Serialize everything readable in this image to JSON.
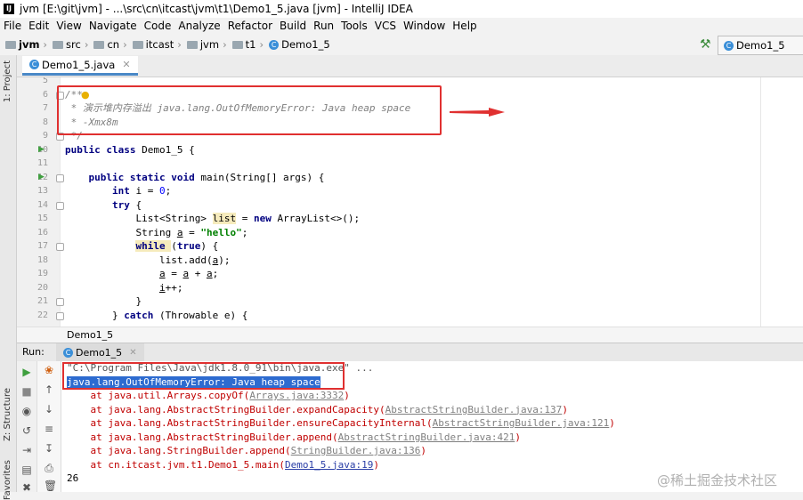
{
  "window": {
    "title": "jvm [E:\\git\\jvm] - ...\\src\\cn\\itcast\\jvm\\t1\\Demo1_5.java [jvm] - IntelliJ IDEA"
  },
  "menu": [
    "File",
    "Edit",
    "View",
    "Navigate",
    "Code",
    "Analyze",
    "Refactor",
    "Build",
    "Run",
    "Tools",
    "VCS",
    "Window",
    "Help"
  ],
  "breadcrumb": [
    "jvm",
    "src",
    "cn",
    "itcast",
    "jvm",
    "t1",
    "Demo1_5"
  ],
  "run_config": "Demo1_5",
  "left_strip": {
    "project": "1: Project",
    "structure": "Z: Structure",
    "favorites": "Favorites"
  },
  "editor_tab": "Demo1_5.java",
  "line_numbers": [
    "5",
    "6",
    "7",
    "8",
    "9",
    "10",
    "11",
    "12",
    "13",
    "14",
    "15",
    "16",
    "17",
    "18",
    "19",
    "20",
    "21",
    "22"
  ],
  "code": {
    "l6": "/**",
    "l7": " * 演示堆内存溢出 java.lang.OutOfMemoryError: Java heap space",
    "l8": " * -Xmx8m",
    "l9": " */",
    "l10a": "public class ",
    "l10b": "Demo1_5 {",
    "l12a": "public static void ",
    "l12b": "main(String[] args) {",
    "l13a": "int ",
    "l13b": "i = ",
    "l13c": "0",
    "l13d": ";",
    "l14a": "try ",
    "l14b": "{",
    "l15a": "List<String> ",
    "l15b": "list",
    "l15c": " = ",
    "l15d": "new ",
    "l15e": "ArrayList<>();",
    "l16a": "String ",
    "l16b": "a",
    "l16c": " = ",
    "l16d": "\"hello\"",
    "l16e": ";",
    "l17a": "while ",
    "l17b": "(",
    "l17c": "true",
    "l17d": ") {",
    "l18a": "list.add(",
    "l18b": "a",
    "l18c": ");",
    "l19a": "a",
    "l19b": " = ",
    "l19c": "a",
    "l19d": " + ",
    "l19e": "a",
    "l19f": ";",
    "l20a": "i",
    "l20b": "++;",
    "l21": "}",
    "l22a": "} ",
    "l22b": "catch ",
    "l22c": "(Throwable e) {"
  },
  "editor_status": "Demo1_5",
  "run_panel": {
    "label": "Run:",
    "tab": "Demo1_5"
  },
  "console": {
    "cmd": "\"C:\\Program Files\\Java\\jdk1.8.0_91\\bin\\java.exe\" ...",
    "error": "java.lang.OutOfMemoryError: Java heap space",
    "trace": [
      {
        "pre": "    at java.util.Arrays.copyOf(",
        "link": "Arrays.java:3332",
        "post": ")"
      },
      {
        "pre": "    at java.lang.AbstractStringBuilder.expandCapacity(",
        "link": "AbstractStringBuilder.java:137",
        "post": ")"
      },
      {
        "pre": "    at java.lang.AbstractStringBuilder.ensureCapacityInternal(",
        "link": "AbstractStringBuilder.java:121",
        "post": ")"
      },
      {
        "pre": "    at java.lang.AbstractStringBuilder.append(",
        "link": "AbstractStringBuilder.java:421",
        "post": ")"
      },
      {
        "pre": "    at java.lang.StringBuilder.append(",
        "link": "StringBuilder.java:136",
        "post": ")"
      },
      {
        "pre": "    at cn.itcast.jvm.t1.Demo1_5.main(",
        "link": "Demo1_5.java:19",
        "post": ")"
      }
    ],
    "last": "26"
  },
  "watermark": "@稀土掘金技术社区",
  "colors": {
    "annotation": "#e03030",
    "selection": "#2d6bd0"
  }
}
